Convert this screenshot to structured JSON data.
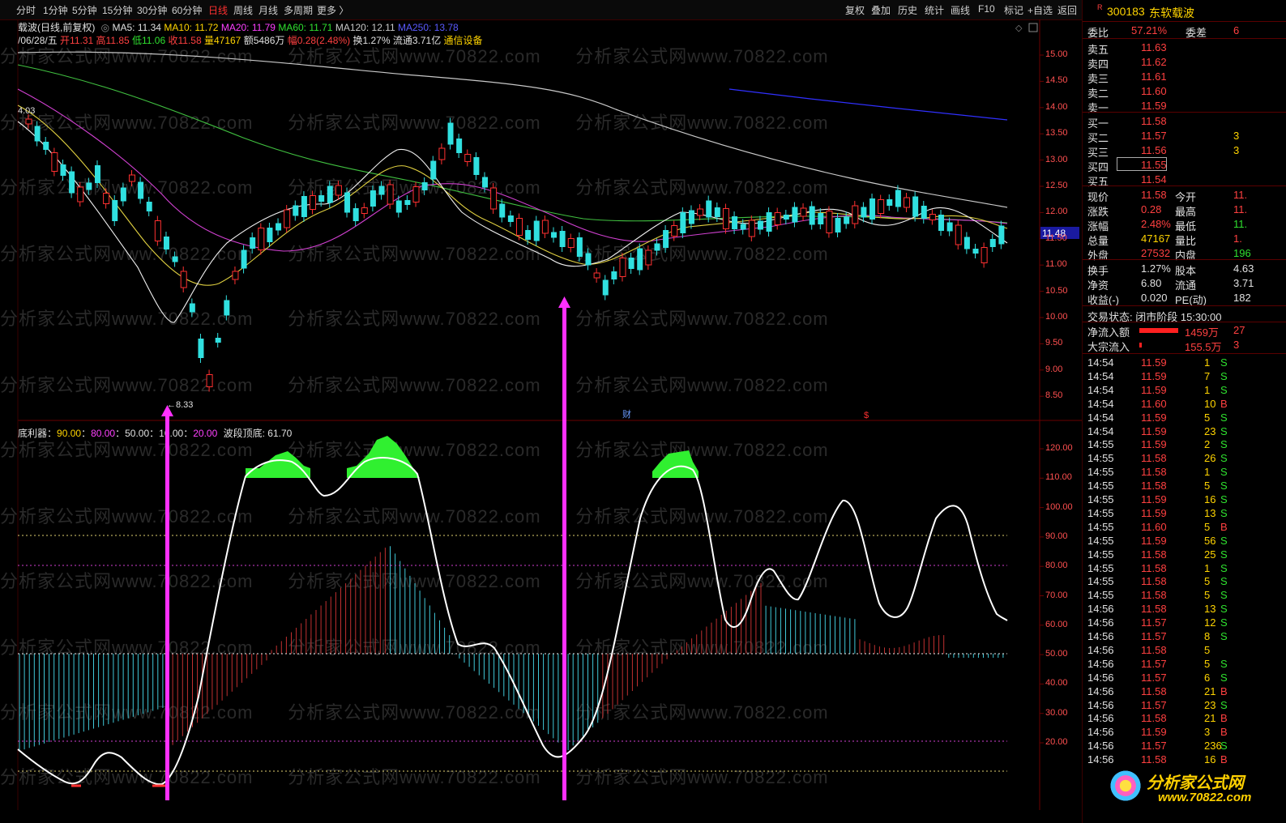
{
  "periods": [
    "分时",
    "1分钟",
    "5分钟",
    "15分钟",
    "30分钟",
    "60分钟",
    "日线",
    "周线",
    "月线",
    "多周期",
    "更多 〉"
  ],
  "active_period": "日线",
  "tools": [
    "复权",
    "叠加",
    "历史",
    "统计",
    "画线",
    "F10",
    "标记",
    "+自选",
    "返回"
  ],
  "chart_title": "载波(日线,前复权)",
  "ma": {
    "ma5": "MA5: 11.34",
    "ma10": "MA10: 11.72",
    "ma20": "MA20: 11.79",
    "ma60": "MA60: 11.71",
    "ma120": "MA120: 12.11",
    "ma250": "MA250: 13.78"
  },
  "bar_info": {
    "date": "/06/28/五",
    "open": "开11.31",
    "high": "高11.85",
    "low": "低11.06",
    "close": "收11.58",
    "volume": "量47167",
    "amount": "额5486万",
    "change": "幅0.28(2.48%)",
    "turnover": "换1.27%",
    "float": "流通3.71亿",
    "sector": "通信设备"
  },
  "low_mark": "←8.33",
  "left_price_mark": "4.03",
  "current_price_tag": "11.48",
  "cai_mark": "财",
  "dollar_mark": "$",
  "price_axis": [
    "15.00",
    "14.50",
    "14.00",
    "13.50",
    "13.00",
    "12.50",
    "12.00",
    "11.50",
    "11.00",
    "10.50",
    "10.00",
    "9.50",
    "9.00",
    "8.50"
  ],
  "osc_axis": [
    "120.00",
    "110.00",
    "100.00",
    "90.00",
    "80.00",
    "70.00",
    "60.00",
    "50.00",
    "40.00",
    "30.00",
    "20.00"
  ],
  "indicator": {
    "name": "底利器",
    "v1": "90.00",
    "v2": "80.00",
    "v3": "50.00",
    "v4": "10.00",
    "v5": "20.00",
    "wave_label": "波段顶底:",
    "wave_value": "61.70"
  },
  "watermark": "分析家公式网www.70822.com",
  "stock": {
    "flag": "R",
    "code": "300183",
    "name": "东软载波"
  },
  "weibi": {
    "label1": "委比",
    "value1": "57.21%",
    "label2": "委差",
    "value2": "6"
  },
  "asks": [
    {
      "label": "卖五",
      "price": "11.63"
    },
    {
      "label": "卖四",
      "price": "11.62"
    },
    {
      "label": "卖三",
      "price": "11.61"
    },
    {
      "label": "卖二",
      "price": "11.60"
    },
    {
      "label": "卖一",
      "price": "11.59"
    }
  ],
  "bids": [
    {
      "label": "买一",
      "price": "11.58",
      "vol": ""
    },
    {
      "label": "买二",
      "price": "11.57",
      "vol": "3"
    },
    {
      "label": "买三",
      "price": "11.56",
      "vol": "3"
    },
    {
      "label": "买四",
      "price": "11.55",
      "vol": ""
    },
    {
      "label": "买五",
      "price": "11.54",
      "vol": ""
    }
  ],
  "quote": [
    {
      "l1": "现价",
      "v1": "11.58",
      "l2": "今开",
      "v2": "11."
    },
    {
      "l1": "涨跌",
      "v1": "0.28",
      "l2": "最高",
      "v2": "11."
    },
    {
      "l1": "涨幅",
      "v1": "2.48%",
      "l2": "最低",
      "v2": "11."
    },
    {
      "l1": "总量",
      "v1": "47167",
      "l2": "量比",
      "v2": "1."
    },
    {
      "l1": "外盘",
      "v1": "27532",
      "l2": "内盘",
      "v2": "196"
    }
  ],
  "quote2": [
    {
      "l1": "换手",
      "v1": "1.27%",
      "l2": "股本",
      "v2": "4.63"
    },
    {
      "l1": "净资",
      "v1": "6.80",
      "l2": "流通",
      "v2": "3.71"
    },
    {
      "l1": "收益(-)",
      "v1": "0.020",
      "l2": "PE(动)",
      "v2": "182"
    }
  ],
  "trade_status": "交易状态: 闭市阶段 15:30:00",
  "net_inflow": {
    "label": "净流入额",
    "value": "1459万",
    "extra": "27"
  },
  "block_inflow": {
    "label": "大宗流入",
    "value": "155.5万",
    "extra": "3"
  },
  "ticks": [
    {
      "t": "14:54",
      "p": "11.59",
      "v": "1",
      "s": "S"
    },
    {
      "t": "14:54",
      "p": "11.59",
      "v": "7",
      "s": "S"
    },
    {
      "t": "14:54",
      "p": "11.59",
      "v": "1",
      "s": "S"
    },
    {
      "t": "14:54",
      "p": "11.60",
      "v": "10",
      "s": "B"
    },
    {
      "t": "14:54",
      "p": "11.59",
      "v": "5",
      "s": "S"
    },
    {
      "t": "14:54",
      "p": "11.59",
      "v": "23",
      "s": "S"
    },
    {
      "t": "14:55",
      "p": "11.59",
      "v": "2",
      "s": "S"
    },
    {
      "t": "14:55",
      "p": "11.58",
      "v": "26",
      "s": "S"
    },
    {
      "t": "14:55",
      "p": "11.58",
      "v": "1",
      "s": "S"
    },
    {
      "t": "14:55",
      "p": "11.58",
      "v": "5",
      "s": "S"
    },
    {
      "t": "14:55",
      "p": "11.59",
      "v": "16",
      "s": "S"
    },
    {
      "t": "14:55",
      "p": "11.59",
      "v": "13",
      "s": "S"
    },
    {
      "t": "14:55",
      "p": "11.60",
      "v": "5",
      "s": "B"
    },
    {
      "t": "14:55",
      "p": "11.59",
      "v": "56",
      "s": "S"
    },
    {
      "t": "14:55",
      "p": "11.58",
      "v": "25",
      "s": "S"
    },
    {
      "t": "14:55",
      "p": "11.58",
      "v": "1",
      "s": "S"
    },
    {
      "t": "14:55",
      "p": "11.58",
      "v": "5",
      "s": "S"
    },
    {
      "t": "14:55",
      "p": "11.58",
      "v": "5",
      "s": "S"
    },
    {
      "t": "14:56",
      "p": "11.58",
      "v": "13",
      "s": "S"
    },
    {
      "t": "14:56",
      "p": "11.57",
      "v": "12",
      "s": "S"
    },
    {
      "t": "14:56",
      "p": "11.57",
      "v": "8",
      "s": "S"
    },
    {
      "t": "14:56",
      "p": "11.58",
      "v": "5",
      "s": ""
    },
    {
      "t": "14:56",
      "p": "11.57",
      "v": "5",
      "s": "S"
    },
    {
      "t": "14:56",
      "p": "11.57",
      "v": "6",
      "s": "S"
    },
    {
      "t": "14:56",
      "p": "11.58",
      "v": "21",
      "s": "B"
    },
    {
      "t": "14:56",
      "p": "11.57",
      "v": "23",
      "s": "S"
    },
    {
      "t": "14:56",
      "p": "11.58",
      "v": "21",
      "s": "B"
    },
    {
      "t": "14:56",
      "p": "11.59",
      "v": "3",
      "s": "B"
    },
    {
      "t": "14:56",
      "p": "11.57",
      "v": "236",
      "s": "S"
    },
    {
      "t": "14:56",
      "p": "11.58",
      "v": "16",
      "s": "B"
    }
  ],
  "logo": {
    "text1": "分析家公式网",
    "text2": "www.70822.com"
  }
}
